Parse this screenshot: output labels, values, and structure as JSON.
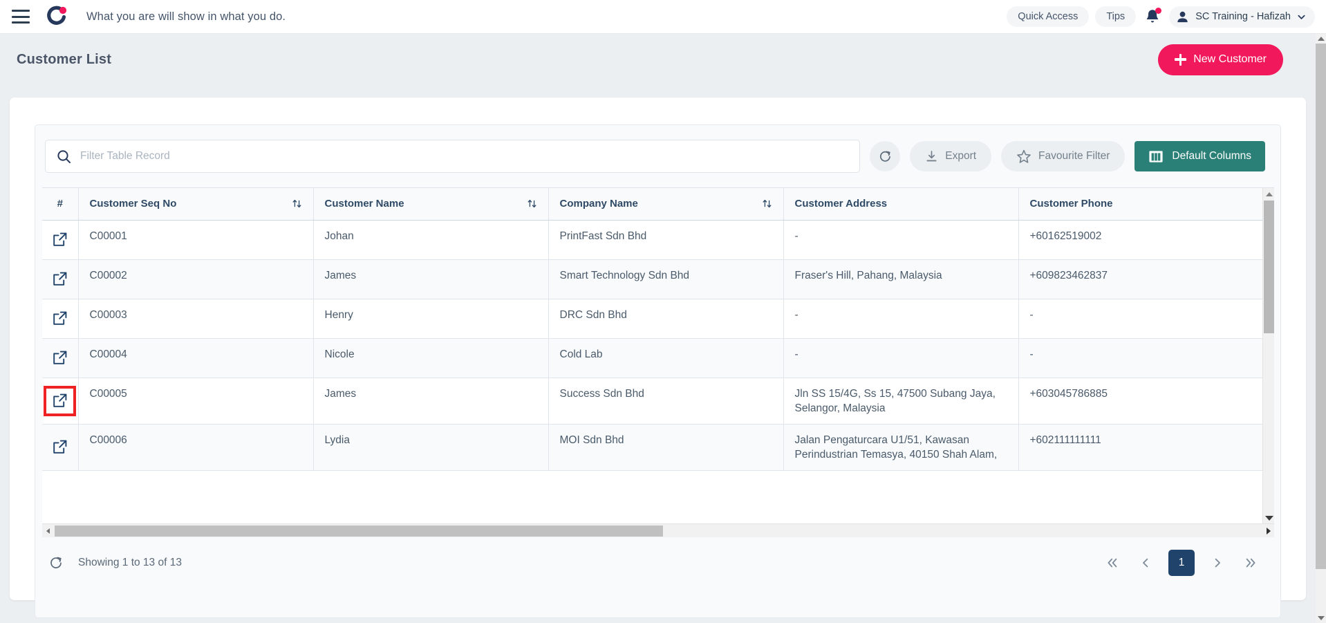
{
  "topbar": {
    "menu_icon": "hamburger-icon",
    "logo_icon": "brand-logo-icon",
    "tagline": "What you are will show in what you do.",
    "quick_access": "Quick Access",
    "tips": "Tips",
    "notification_icon": "bell-icon",
    "user_name": "SC Training - Hafizah"
  },
  "page": {
    "title": "Customer List",
    "new_customer": "New Customer"
  },
  "toolbar": {
    "search_placeholder": "Filter Table Record",
    "search_value": "",
    "refresh_icon": "refresh-icon",
    "export": "Export",
    "favourite_filter": "Favourite Filter",
    "default_columns": "Default Columns"
  },
  "table": {
    "columns": [
      {
        "label": "#",
        "sortable": false
      },
      {
        "label": "Customer Seq No",
        "sortable": true
      },
      {
        "label": "Customer Name",
        "sortable": true
      },
      {
        "label": "Company Name",
        "sortable": true
      },
      {
        "label": "Customer Address",
        "sortable": false
      },
      {
        "label": "Customer Phone",
        "sortable": false
      }
    ],
    "rows": [
      {
        "seq_no": "C00001",
        "customer_name": "Johan",
        "company_name": "PrintFast Sdn Bhd",
        "address": "-",
        "phone": "+60162519002",
        "highlighted": false
      },
      {
        "seq_no": "C00002",
        "customer_name": "James",
        "company_name": "Smart Technology Sdn Bhd",
        "address": "Fraser's Hill, Pahang, Malaysia",
        "phone": "+609823462837",
        "highlighted": false
      },
      {
        "seq_no": "C00003",
        "customer_name": "Henry",
        "company_name": "DRC Sdn Bhd",
        "address": "-",
        "phone": "-",
        "highlighted": false
      },
      {
        "seq_no": "C00004",
        "customer_name": "Nicole",
        "company_name": "Cold Lab",
        "address": "-",
        "phone": "-",
        "highlighted": false
      },
      {
        "seq_no": "C00005",
        "customer_name": "James",
        "company_name": "Success Sdn Bhd",
        "address": "Jln SS 15/4G, Ss 15, 47500 Subang Jaya, Selangor, Malaysia",
        "phone": "+603045786885",
        "highlighted": true
      },
      {
        "seq_no": "C00006",
        "customer_name": "Lydia",
        "company_name": "MOI Sdn Bhd",
        "address": "Jalan Pengaturcara U1/51, Kawasan Perindustrian Temasya, 40150 Shah Alam,",
        "phone": "+602111111111",
        "highlighted": false
      }
    ]
  },
  "footer": {
    "refresh_icon": "refresh-icon",
    "showing": "Showing 1 to 13 of 13",
    "first_page": "«",
    "prev_page": "‹",
    "current_page": "1",
    "next_page": "›",
    "last_page": "»"
  },
  "colors": {
    "brand_pink": "#f2185c",
    "brand_navy": "#20436b",
    "teal": "#2a8077",
    "highlight_red": "#ee2222",
    "page_bg": "#eceff1"
  }
}
